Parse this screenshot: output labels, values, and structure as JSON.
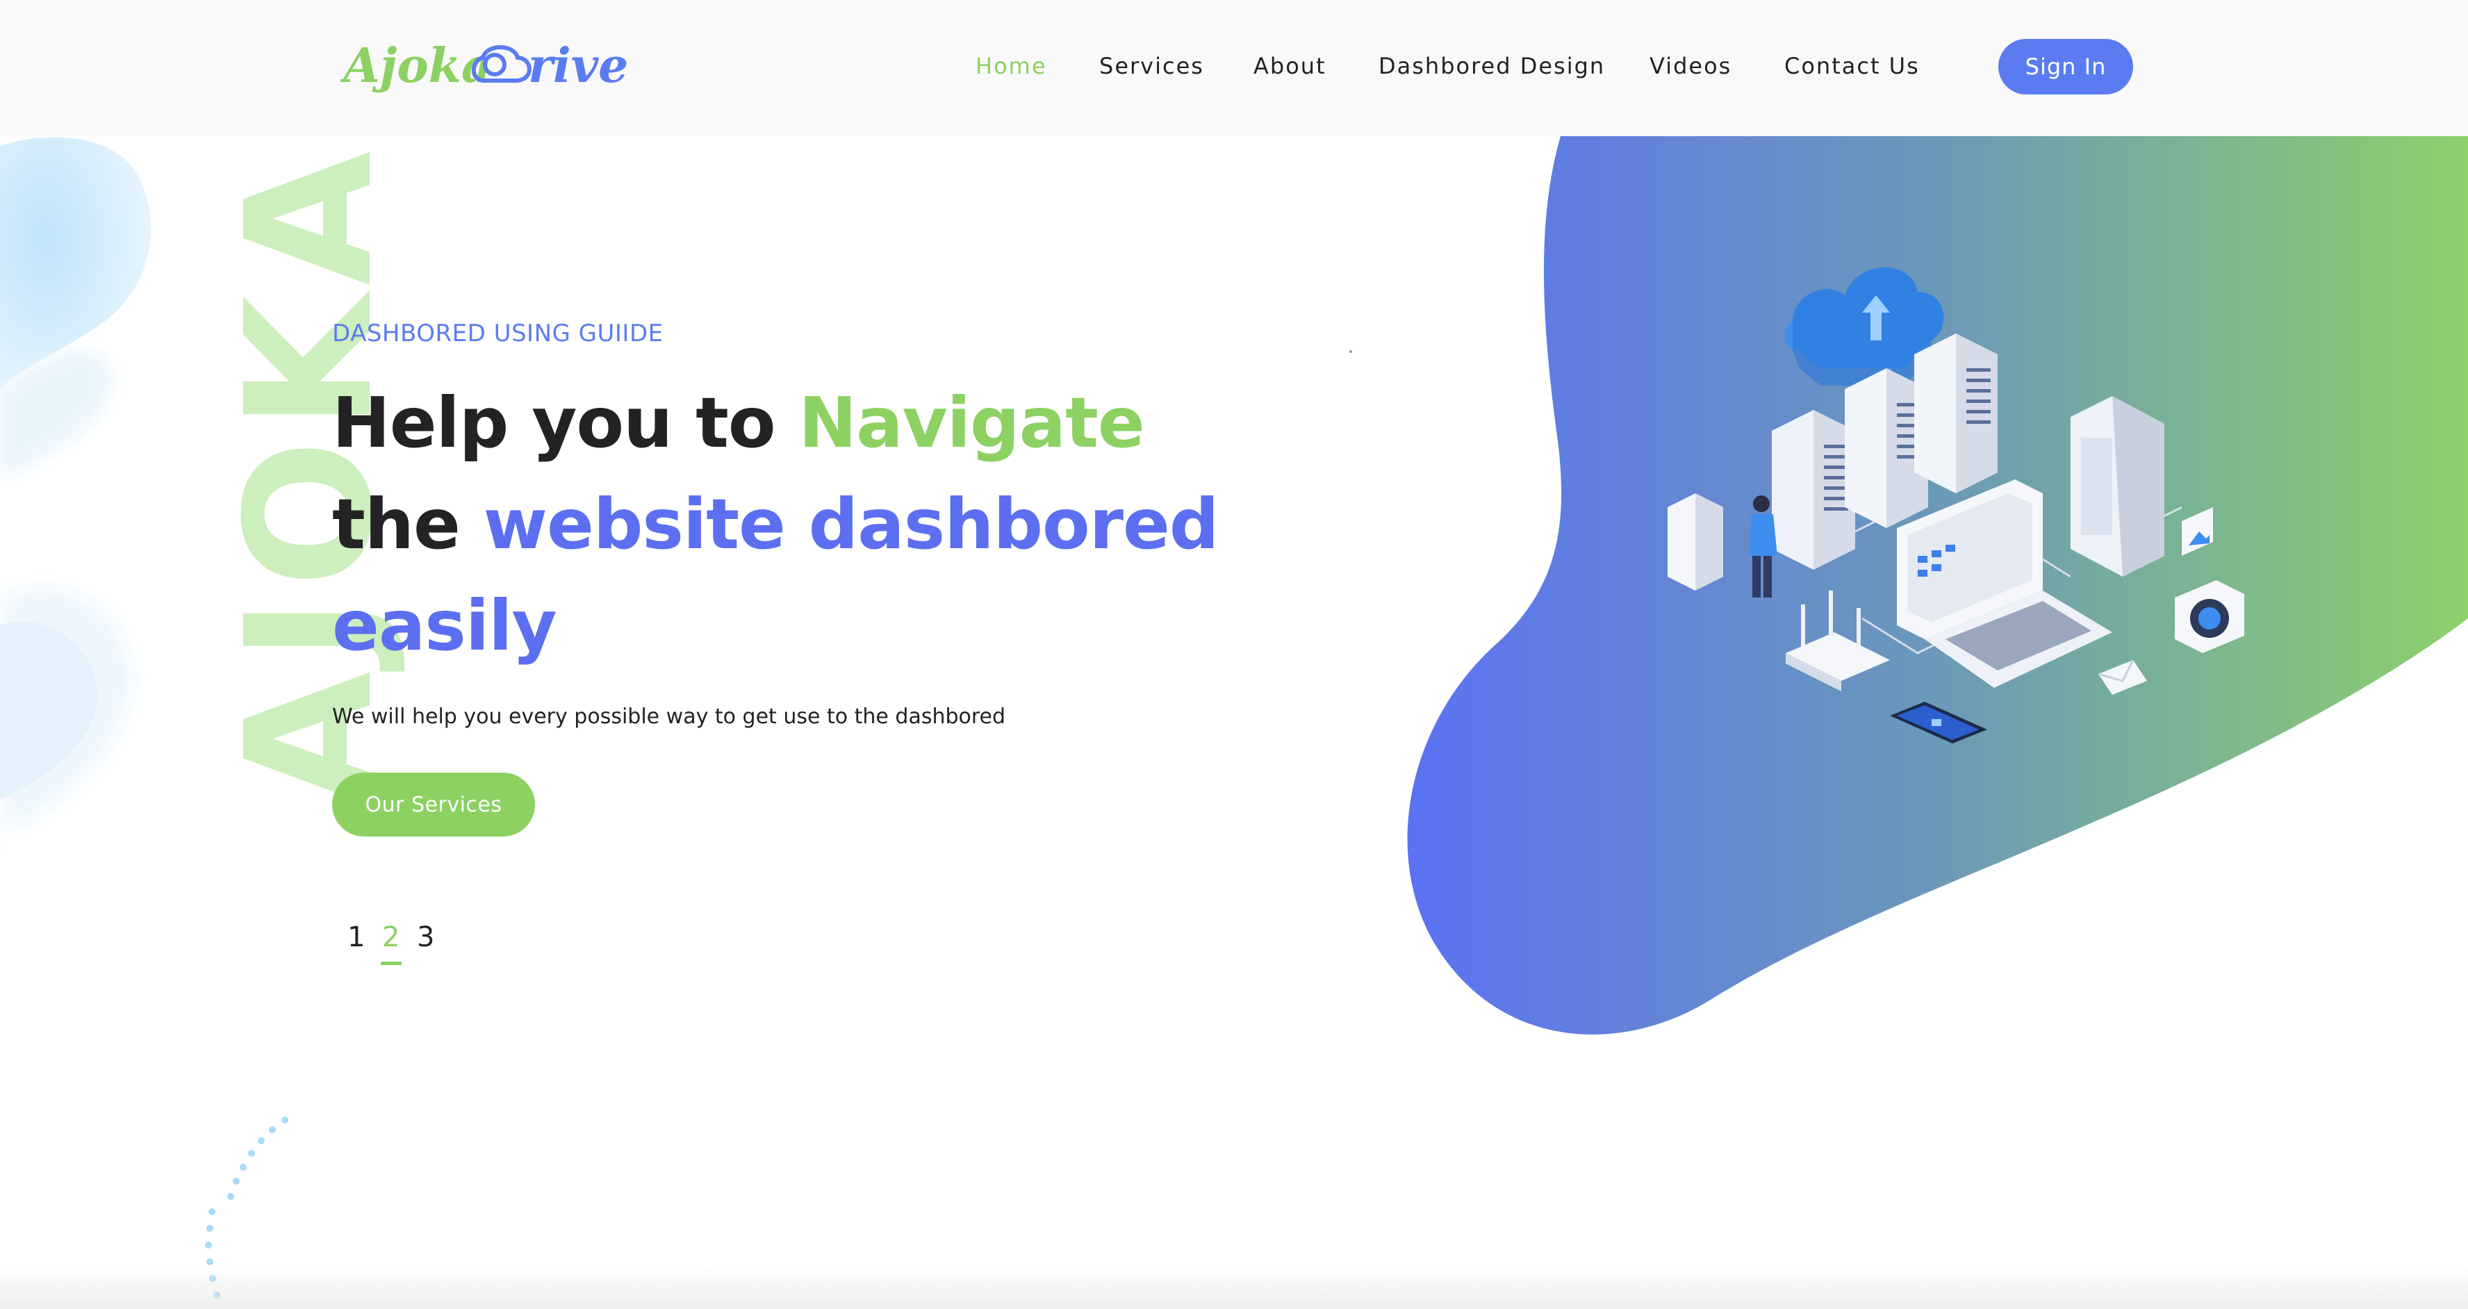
{
  "brand": {
    "logo_text": "AjokaDrive"
  },
  "nav": {
    "items": [
      {
        "label": "Home",
        "active": true
      },
      {
        "label": "Services",
        "active": false
      },
      {
        "label": "About",
        "active": false
      },
      {
        "label": "Dashbored Design",
        "active": false
      },
      {
        "label": "Videos",
        "active": false
      },
      {
        "label": "Contact Us",
        "active": false
      }
    ],
    "signin_label": "Sign In"
  },
  "hero": {
    "watermark": "AJOKA",
    "eyebrow": "DASHBORED USING GUIIDE",
    "headline": {
      "line1_plain": "Help you to ",
      "line1_green": "Navigate",
      "line2_plain": "the ",
      "line2_blue": "website dashbored",
      "line3_blue": "easily"
    },
    "subtitle": "We will help you every possible way to get use to the dashbored",
    "cta_label": "Our Services",
    "pager": {
      "pages": [
        "1",
        "2",
        "3"
      ],
      "current": "2"
    }
  },
  "colors": {
    "accent_green": "#8cd162",
    "accent_blue": "#5b7cf0",
    "header_bg": "#f9f9f9",
    "watermark": "#cdeebd"
  },
  "icons": [
    "logo-mark",
    "cloud-icon",
    "server-icon",
    "laptop-icon",
    "phone-icon",
    "router-icon",
    "camera-icon",
    "envelope-icon",
    "person-figure"
  ]
}
